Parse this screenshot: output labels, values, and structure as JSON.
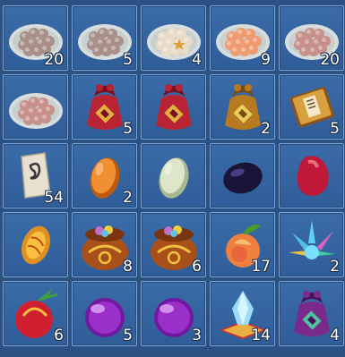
{
  "inventory": {
    "colors": {
      "panel": "#2c5283",
      "slot": "#3b6ca8",
      "slot_border": "#78a6d8",
      "qty_text": "#ffffff"
    },
    "slots": [
      {
        "icon": "plate-dumplings-icon",
        "qty": "20"
      },
      {
        "icon": "plate-dumplings-icon",
        "qty": "5"
      },
      {
        "icon": "plate-dumplings-star-icon",
        "qty": "4"
      },
      {
        "icon": "plate-dumplings-orange-icon",
        "qty": "9"
      },
      {
        "icon": "plate-dumplings-pink-icon",
        "qty": "20"
      },
      {
        "icon": "plate-dumplings-pink-icon",
        "qty": ""
      },
      {
        "icon": "red-pouch-icon",
        "qty": "5"
      },
      {
        "icon": "red-pouch-icon",
        "qty": ""
      },
      {
        "icon": "gold-pouch-icon",
        "qty": "2"
      },
      {
        "icon": "book-icon",
        "qty": "5"
      },
      {
        "icon": "scroll-icon",
        "qty": "54"
      },
      {
        "icon": "orange-egg-icon",
        "qty": "2"
      },
      {
        "icon": "jade-egg-icon",
        "qty": ""
      },
      {
        "icon": "dark-gem-icon",
        "qty": ""
      },
      {
        "icon": "red-gem-icon",
        "qty": ""
      },
      {
        "icon": "amber-gem-icon",
        "qty": ""
      },
      {
        "icon": "treasure-bag-icon",
        "qty": "8"
      },
      {
        "icon": "treasure-bag-icon",
        "qty": "6"
      },
      {
        "icon": "peach-icon",
        "qty": "17"
      },
      {
        "icon": "crystal-cluster-icon",
        "qty": "2"
      },
      {
        "icon": "red-fruit-icon",
        "qty": "6"
      },
      {
        "icon": "purple-orb-icon",
        "qty": "5"
      },
      {
        "icon": "purple-orb-icon",
        "qty": "3"
      },
      {
        "icon": "crystal-cushion-icon",
        "qty": "14"
      },
      {
        "icon": "purple-pouch-icon",
        "qty": "4"
      }
    ]
  }
}
